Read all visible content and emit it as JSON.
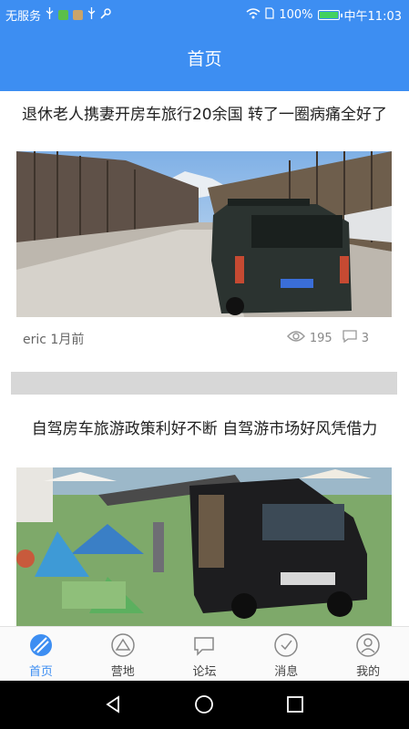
{
  "status_bar": {
    "carrier": "无服务",
    "battery": "100%",
    "time": "中午11:03"
  },
  "header": {
    "title": "首页"
  },
  "feed": [
    {
      "title": "退休老人携妻开房车旅行20余国 转了一圈病痛全好了",
      "author_time": "eric 1月前",
      "views": "195",
      "comments": "3"
    },
    {
      "title": "自驾房车旅游政策利好不断 自驾游市场好风凭借力"
    }
  ],
  "bottom_nav": [
    {
      "label": "首页",
      "icon": "home-icon",
      "active": true
    },
    {
      "label": "营地",
      "icon": "camp-icon",
      "active": false
    },
    {
      "label": "论坛",
      "icon": "forum-icon",
      "active": false
    },
    {
      "label": "消息",
      "icon": "message-icon",
      "active": false
    },
    {
      "label": "我的",
      "icon": "profile-icon",
      "active": false
    }
  ],
  "colors": {
    "accent": "#3d8ef2",
    "divider": "#d7d7d7"
  }
}
